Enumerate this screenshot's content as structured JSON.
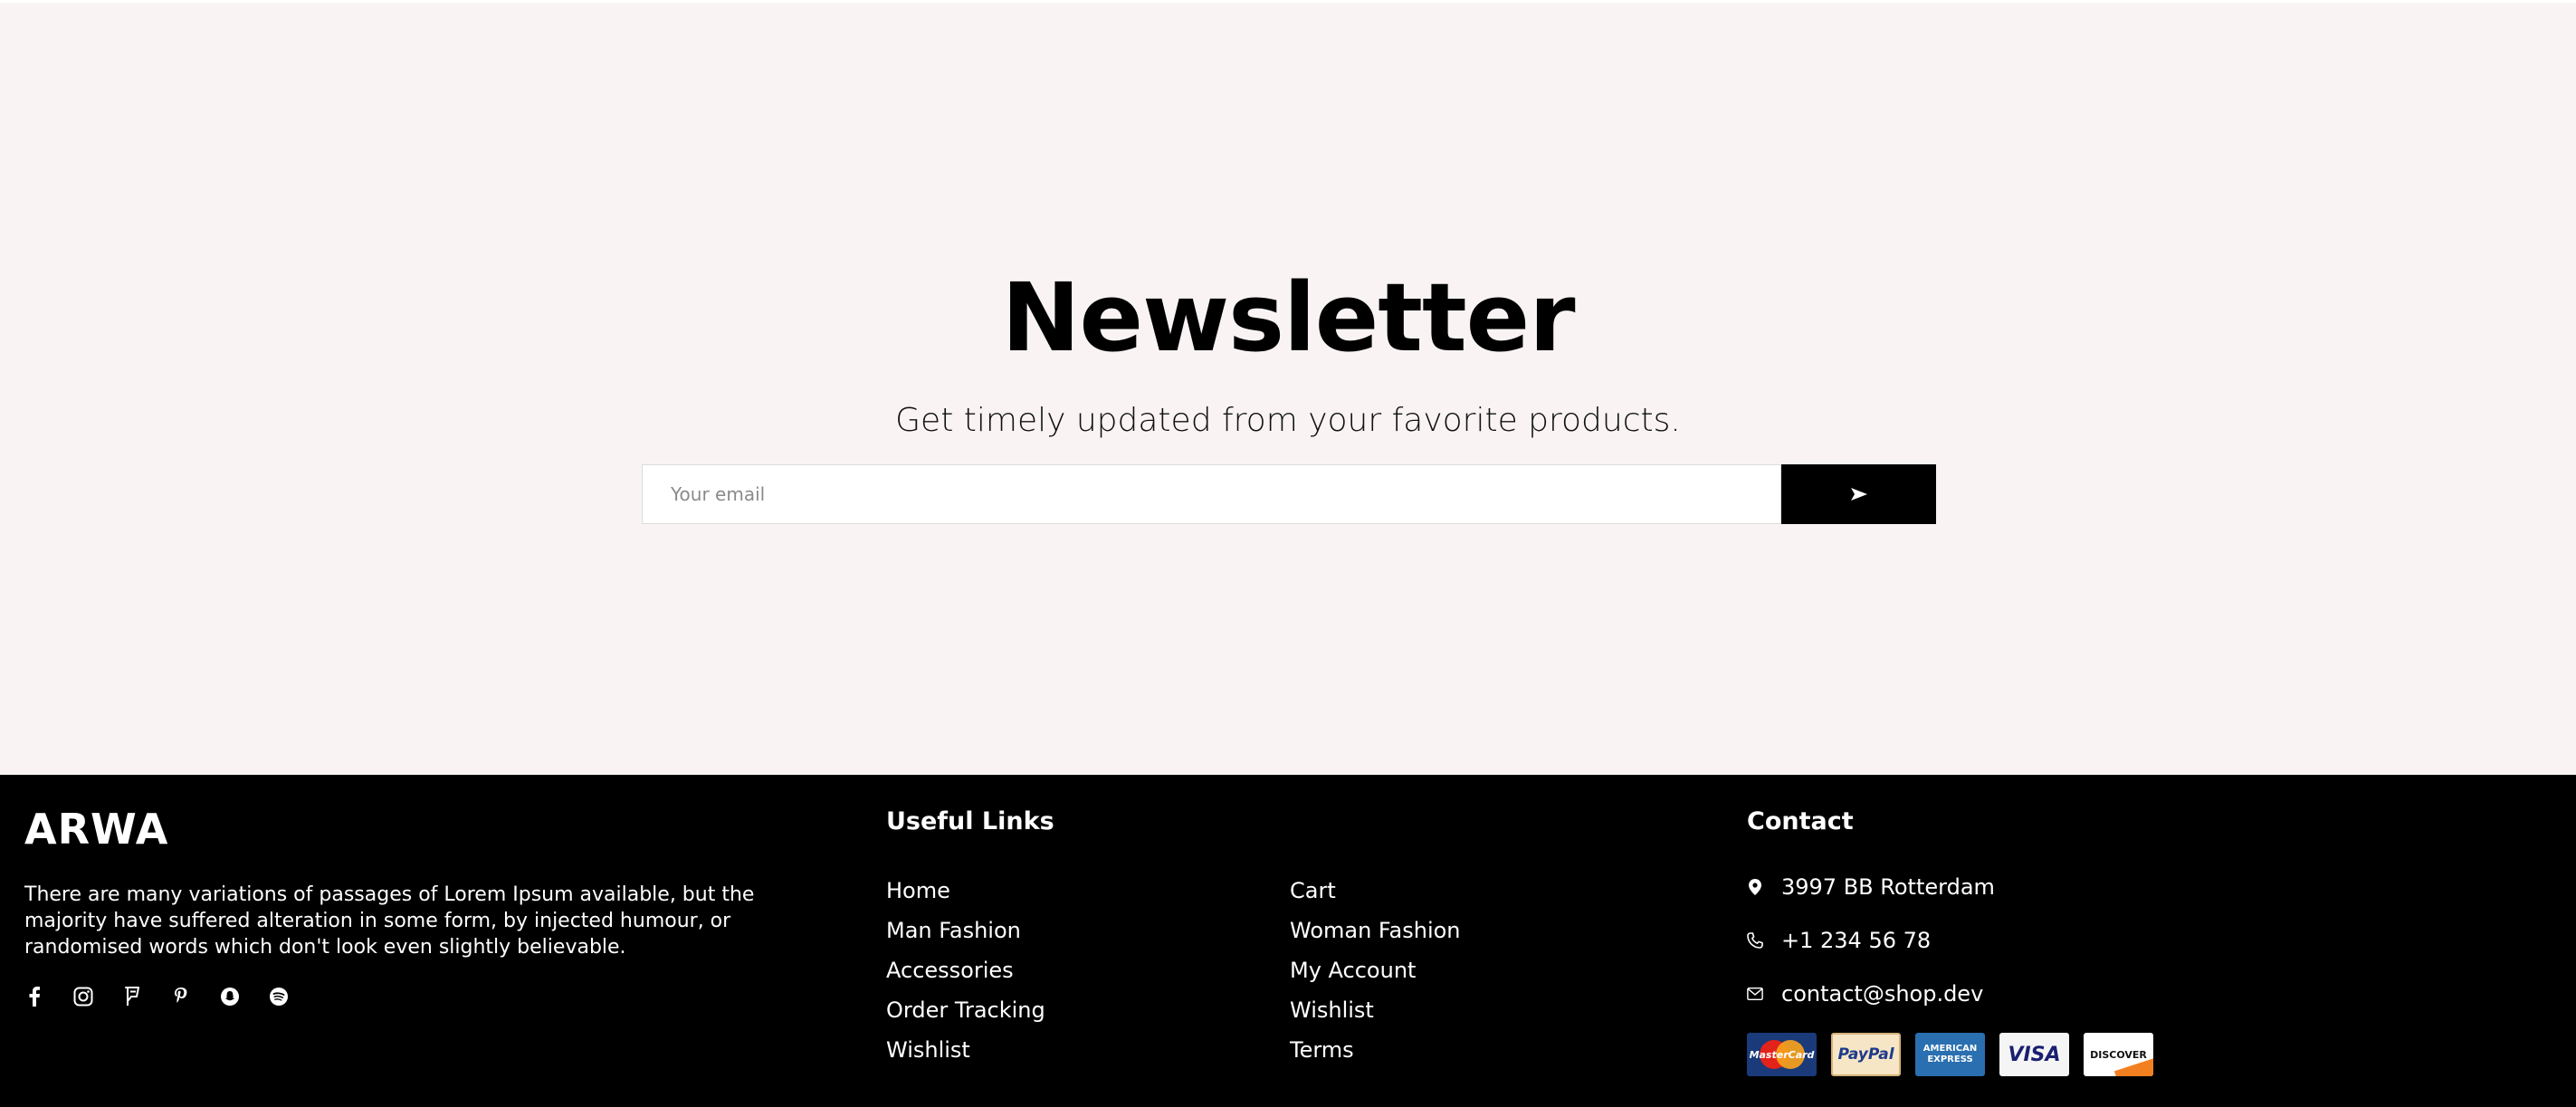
{
  "newsletter": {
    "title": "Newsletter",
    "subtitle": "Get timely updated from your favorite products.",
    "email_placeholder": "Your email",
    "submit_icon": "send-arrow-icon"
  },
  "footer": {
    "brand": "ARWA",
    "about": "There are many variations of passages of Lorem Ipsum available, but the majority have suffered alteration in some form, by injected humour, or randomised words which don't look even slightly believable.",
    "socials": [
      "facebook-icon",
      "instagram-icon",
      "foursquare-icon",
      "pinterest-icon",
      "snapchat-icon",
      "spotify-icon"
    ],
    "useful_links_title": "Useful Links",
    "links_left": [
      "Home",
      "Man Fashion",
      "Accessories",
      "Order Tracking",
      "Wishlist"
    ],
    "links_right": [
      "Cart",
      "Woman Fashion",
      "My Account",
      "Wishlist",
      "Terms"
    ],
    "contact_title": "Contact",
    "contact": {
      "address": "3997 BB Rotterdam",
      "phone": "+1 234 56 78",
      "email": "contact@shop.dev"
    },
    "payments": {
      "mastercard": "MasterCard",
      "paypal": "PayPal",
      "amex": "AMERICAN EXPRESS",
      "visa": "VISA",
      "discover": "DISCOVER"
    }
  },
  "colors": {
    "background": "#f9f4f3",
    "footer": "#000000",
    "accent": "#000000"
  }
}
